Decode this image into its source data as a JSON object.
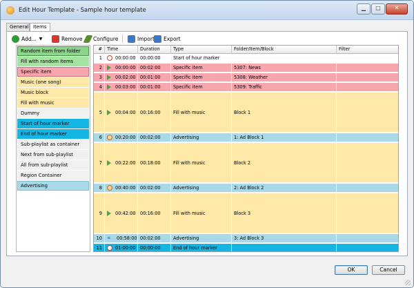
{
  "window": {
    "title": "Edit Hour Template - Sample hour template"
  },
  "tabs": [
    {
      "label": "General"
    },
    {
      "label": "Items"
    }
  ],
  "toolbar": {
    "add": "Add...",
    "remove": "Remove",
    "configure": "Configure",
    "import": "Import",
    "export": "Export"
  },
  "item_types": [
    {
      "label": "Random item from folder",
      "bg": "#8fd48e",
      "border": "#3b9b3a"
    },
    {
      "label": "Fill with random items",
      "bg": "#a4e3a0",
      "border": "#a4e3a0"
    },
    {
      "label": "Specific item",
      "bg": "#f7a6ae",
      "border": "#d96a77"
    },
    {
      "label": "Music (one song)",
      "bg": "#fde8a8",
      "border": "#fde8a8"
    },
    {
      "label": "Music block",
      "bg": "#fde8a8",
      "border": "#fde8a8"
    },
    {
      "label": "Fill with music",
      "bg": "#fde8a8",
      "border": "#fde8a8"
    },
    {
      "label": "Dummy",
      "bg": "#f0f0f0",
      "border": "#f0f0f0"
    },
    {
      "label": "Start of hour marker",
      "bg": "#13b5e3",
      "border": "#13b5e3"
    },
    {
      "label": "End of hour marker",
      "bg": "#13b5e3",
      "border": "#13b5e3"
    },
    {
      "label": "Sub-playlist as container",
      "bg": "#f0f0f0",
      "border": "#f0f0f0"
    },
    {
      "label": "Next from sub-playlist",
      "bg": "#f0f0f0",
      "border": "#f0f0f0"
    },
    {
      "label": "All from sub-playlist",
      "bg": "#f0f0f0",
      "border": "#f0f0f0"
    },
    {
      "label": "Region Container",
      "bg": "#f0f0f0",
      "border": "#f0f0f0"
    },
    {
      "label": "Advertising",
      "bg": "#a9d9e6",
      "border": "#7fbfd2"
    }
  ],
  "grid": {
    "columns": [
      "#",
      "Time",
      "Duration",
      "Type",
      "Folder/Item/Block",
      "Filter"
    ],
    "rows": [
      {
        "n": "1",
        "time": "00:00:00",
        "duration": "00:00:00",
        "type": "Start of hour marker",
        "folder": "",
        "icon": "marker",
        "bg": "#ffffff",
        "tall": false
      },
      {
        "n": "2",
        "time": "00:00:00",
        "duration": "00:02:00",
        "type": "Specific item",
        "folder": "5307: News",
        "icon": "play",
        "bg": "#f7a6ae",
        "tall": false
      },
      {
        "n": "3",
        "time": "00:02:00",
        "duration": "00:01:00",
        "type": "Specific item",
        "folder": "5308: Weather",
        "icon": "play",
        "bg": "#f7a6ae",
        "tall": false
      },
      {
        "n": "4",
        "time": "00:03:00",
        "duration": "00:01:00",
        "type": "Specific item",
        "folder": "5309: Traffic",
        "icon": "play",
        "bg": "#f7a6ae",
        "tall": false
      },
      {
        "n": "5",
        "time": "00:04:00",
        "duration": "00:16:00",
        "type": "Fill with music",
        "folder": "Block 1",
        "icon": "play",
        "bg": "#fde8a8",
        "tall": true
      },
      {
        "n": "6",
        "time": "00:20:00",
        "duration": "00:02:00",
        "type": "Advertising",
        "folder": "1: Ad Block 1",
        "icon": "circle",
        "bg": "#a9d9e6",
        "tall": false
      },
      {
        "n": "7",
        "time": "00:22:00",
        "duration": "00:18:00",
        "type": "Fill with music",
        "folder": "Block 2",
        "icon": "play",
        "bg": "#fde8a8",
        "tall": true
      },
      {
        "n": "8",
        "time": "00:40:00",
        "duration": "00:02:00",
        "type": "Advertising",
        "folder": "2: Ad Block 2",
        "icon": "circle",
        "bg": "#a9d9e6",
        "tall": false
      },
      {
        "n": "9",
        "time": "00:42:00",
        "duration": "00:16:00",
        "type": "Fill with music",
        "folder": "Block 3",
        "icon": "play",
        "bg": "#fde8a8",
        "tall": true
      },
      {
        "n": "10",
        "time": "00:58:00",
        "duration": "00:02:00",
        "type": "Advertising",
        "folder": "3: Ad Block 3",
        "icon": "rewind",
        "bg": "#a9d9e6",
        "tall": false
      },
      {
        "n": "11",
        "time": "01:00:00",
        "duration": "00:00:00",
        "type": "End of hour marker",
        "folder": "",
        "icon": "marker",
        "bg": "#13b5e3",
        "tall": false
      }
    ]
  },
  "buttons": {
    "ok": "OK",
    "cancel": "Cancel"
  }
}
